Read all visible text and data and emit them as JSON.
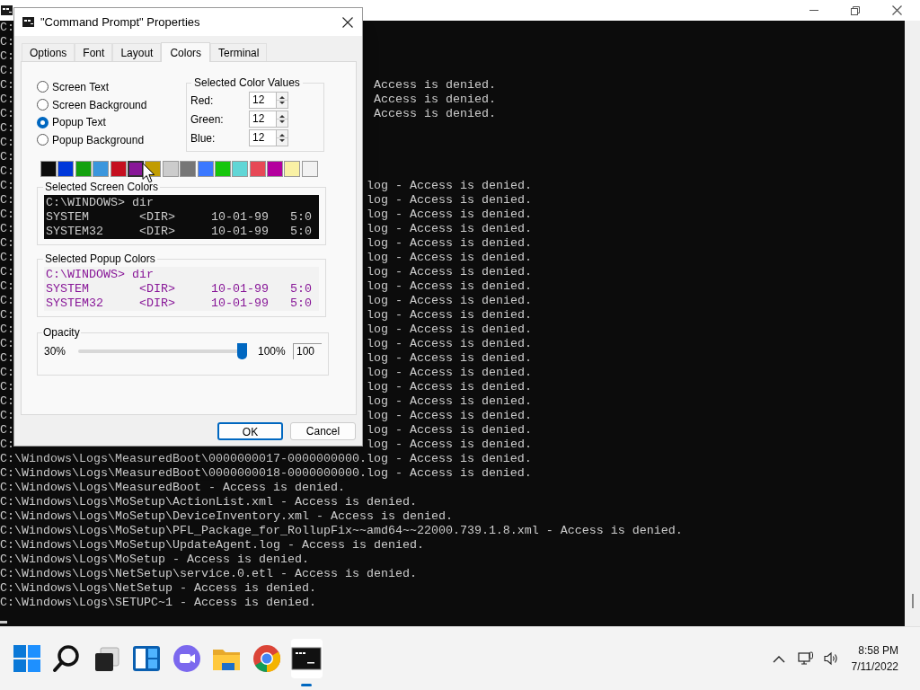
{
  "console": {
    "lines": [
      {
        "kind": "clipped",
        "left": "C:"
      },
      {
        "kind": "clipped",
        "left": "C:"
      },
      {
        "kind": "clipped",
        "left": "C:"
      },
      {
        "kind": "clipped",
        "left": "C:"
      },
      {
        "kind": "clipped_msg",
        "left": "C:",
        "right": "Access is denied."
      },
      {
        "kind": "clipped_msg",
        "left": "C:",
        "right": "Access is denied."
      },
      {
        "kind": "clipped_msg",
        "left": "C:",
        "right": "Access is denied."
      },
      {
        "kind": "clipped",
        "left": "C:"
      },
      {
        "kind": "clipped",
        "left": "C:"
      },
      {
        "kind": "clipped",
        "left": "C:"
      },
      {
        "kind": "clipped",
        "left": "C:"
      },
      {
        "kind": "clipped_log",
        "left": "C:",
        "right": "log - Access is denied."
      },
      {
        "kind": "clipped_log",
        "left": "C:",
        "right": "log - Access is denied."
      },
      {
        "kind": "clipped_log",
        "left": "C:",
        "right": "log - Access is denied."
      },
      {
        "kind": "clipped_log",
        "left": "C:",
        "right": "log - Access is denied."
      },
      {
        "kind": "clipped_log",
        "left": "C:",
        "right": "log - Access is denied."
      },
      {
        "kind": "clipped_log",
        "left": "C:",
        "right": "log - Access is denied."
      },
      {
        "kind": "clipped_log",
        "left": "C:",
        "right": "log - Access is denied."
      },
      {
        "kind": "clipped_log",
        "left": "C:",
        "right": "log - Access is denied."
      },
      {
        "kind": "clipped_log",
        "left": "C:",
        "right": "log - Access is denied."
      },
      {
        "kind": "clipped_log",
        "left": "C:",
        "right": "log - Access is denied."
      },
      {
        "kind": "clipped_log",
        "left": "C:",
        "right": "log - Access is denied."
      },
      {
        "kind": "clipped_log",
        "left": "C:",
        "right": "log - Access is denied."
      },
      {
        "kind": "clipped_log",
        "left": "C:",
        "right": "log - Access is denied."
      },
      {
        "kind": "clipped_log",
        "left": "C:",
        "right": "log - Access is denied."
      },
      {
        "kind": "clipped_log",
        "left": "C:",
        "right": "log - Access is denied."
      },
      {
        "kind": "clipped_log",
        "left": "C:",
        "right": "log - Access is denied."
      },
      {
        "kind": "clipped_log",
        "left": "C:",
        "right": "log - Access is denied."
      },
      {
        "kind": "clipped_log",
        "left": "C:",
        "right": "log - Access is denied."
      },
      {
        "kind": "clipped_log",
        "left": "C:",
        "right": "log - Access is denied."
      },
      {
        "kind": "full",
        "text": "C:\\Windows\\Logs\\MeasuredBoot\\0000000017-0000000000.log - Access is denied."
      },
      {
        "kind": "full",
        "text": "C:\\Windows\\Logs\\MeasuredBoot\\0000000018-0000000000.log - Access is denied."
      },
      {
        "kind": "full",
        "text": "C:\\Windows\\Logs\\MeasuredBoot - Access is denied."
      },
      {
        "kind": "full",
        "text": "C:\\Windows\\Logs\\MoSetup\\ActionList.xml - Access is denied."
      },
      {
        "kind": "full",
        "text": "C:\\Windows\\Logs\\MoSetup\\DeviceInventory.xml - Access is denied."
      },
      {
        "kind": "full",
        "text": "C:\\Windows\\Logs\\MoSetup\\PFL_Package_for_RollupFix~~amd64~~22000.739.1.8.xml - Access is denied."
      },
      {
        "kind": "full",
        "text": "C:\\Windows\\Logs\\MoSetup\\UpdateAgent.log - Access is denied."
      },
      {
        "kind": "full",
        "text": "C:\\Windows\\Logs\\MoSetup - Access is denied."
      },
      {
        "kind": "full",
        "text": "C:\\Windows\\Logs\\NetSetup\\service.0.etl - Access is denied."
      },
      {
        "kind": "full",
        "text": "C:\\Windows\\Logs\\NetSetup - Access is denied."
      },
      {
        "kind": "full",
        "text": "C:\\Windows\\Logs\\SETUPC~1 - Access is denied."
      }
    ]
  },
  "dialog": {
    "title": "\"Command Prompt\" Properties",
    "tabs": [
      {
        "label": "Options",
        "selected": false
      },
      {
        "label": "Font",
        "selected": false
      },
      {
        "label": "Layout",
        "selected": false
      },
      {
        "label": "Colors",
        "selected": true
      },
      {
        "label": "Terminal",
        "selected": false
      }
    ],
    "color_targets": [
      {
        "label": "Screen Text",
        "selected": false
      },
      {
        "label": "Screen Background",
        "selected": false
      },
      {
        "label": "Popup Text",
        "selected": true
      },
      {
        "label": "Popup Background",
        "selected": false
      }
    ],
    "color_values": {
      "title": "Selected Color Values",
      "fields": [
        {
          "label": "Red:",
          "value": "12"
        },
        {
          "label": "Green:",
          "value": "12"
        },
        {
          "label": "Blue:",
          "value": "12"
        }
      ]
    },
    "palette": [
      {
        "color": "#0c0c0c",
        "selected": false
      },
      {
        "color": "#0037da",
        "selected": false
      },
      {
        "color": "#13a10e",
        "selected": false
      },
      {
        "color": "#3a96dd",
        "selected": false
      },
      {
        "color": "#c50f1f",
        "selected": false
      },
      {
        "color": "#881798",
        "selected": true
      },
      {
        "color": "#c19c00",
        "selected": false
      },
      {
        "color": "#cccccc",
        "selected": false
      },
      {
        "color": "#767676",
        "selected": false
      },
      {
        "color": "#3b78ff",
        "selected": false
      },
      {
        "color": "#16c60c",
        "selected": false
      },
      {
        "color": "#61d6d6",
        "selected": false
      },
      {
        "color": "#e74856",
        "selected": false
      },
      {
        "color": "#b4009e",
        "selected": false
      },
      {
        "color": "#f9f1a5",
        "selected": false
      },
      {
        "color": "#f2f2f2",
        "selected": false
      }
    ],
    "screen_preview": {
      "title": "Selected Screen Colors",
      "lines": [
        "C:\\WINDOWS> dir",
        "SYSTEM       <DIR>     10-01-99   5:0",
        "SYSTEM32     <DIR>     10-01-99   5:0"
      ]
    },
    "popup_preview": {
      "title": "Selected Popup Colors",
      "lines": [
        "C:\\WINDOWS> dir",
        "SYSTEM       <DIR>     10-01-99   5:0",
        "SYSTEM32     <DIR>     10-01-99   5:0"
      ]
    },
    "opacity": {
      "title": "Opacity",
      "min_label": "30%",
      "max_label": "100%",
      "level": 1,
      "value": "100"
    },
    "buttons": [
      {
        "label": "OK",
        "default": true
      },
      {
        "label": "Cancel",
        "default": false
      }
    ]
  },
  "taskbar": {
    "apps": [
      {
        "kind": "start",
        "active": false
      },
      {
        "kind": "search",
        "active": false
      },
      {
        "kind": "taskview",
        "active": false
      },
      {
        "kind": "widgets",
        "active": false
      },
      {
        "kind": "chat",
        "active": false
      },
      {
        "kind": "explorer",
        "active": false
      },
      {
        "kind": "browser",
        "active": false
      },
      {
        "kind": "terminal",
        "active": true
      }
    ],
    "clock": {
      "time": "8:58 PM",
      "date": "7/11/2022"
    }
  }
}
